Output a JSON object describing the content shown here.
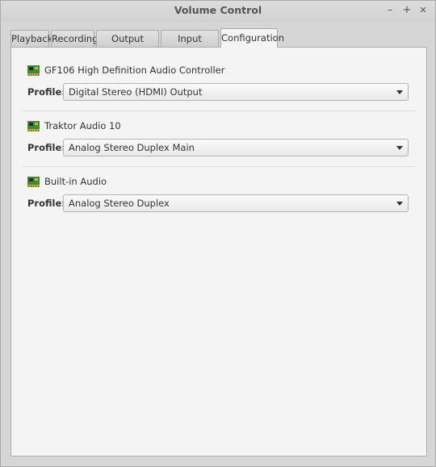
{
  "window": {
    "title": "Volume Control",
    "minimize": "–",
    "maximize": "+",
    "close": "✕"
  },
  "tabs": [
    {
      "label": "Playback",
      "active": false
    },
    {
      "label": "Recording",
      "active": false
    },
    {
      "label": "Output Devices",
      "active": false
    },
    {
      "label": "Input Devices",
      "active": false
    },
    {
      "label": "Configuration",
      "active": true
    }
  ],
  "profile_label": "Profile:",
  "devices": [
    {
      "icon": "sound-card-icon",
      "name": "GF106 High Definition Audio Controller",
      "profile": "Digital Stereo (HDMI) Output"
    },
    {
      "icon": "sound-card-icon",
      "name": "Traktor Audio 10",
      "profile": "Analog Stereo Duplex Main"
    },
    {
      "icon": "sound-card-icon",
      "name": "Built-in Audio",
      "profile": "Analog Stereo Duplex"
    }
  ]
}
